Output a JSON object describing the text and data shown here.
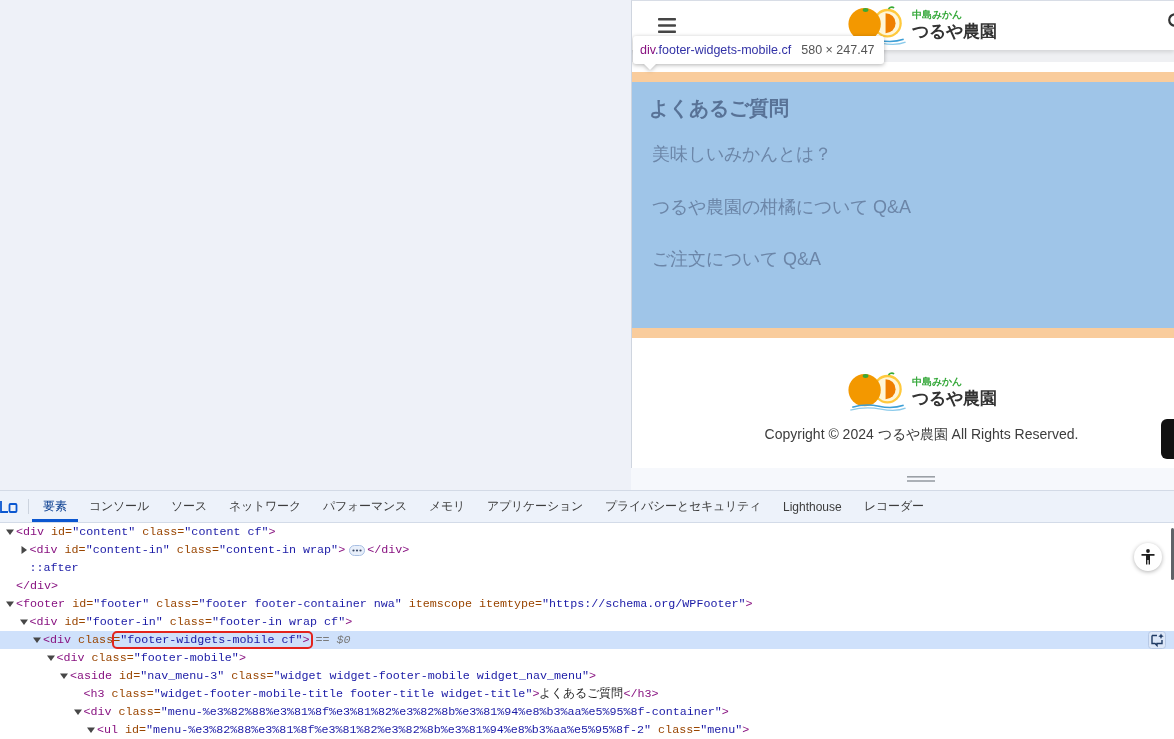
{
  "viewport": {
    "header": {
      "logo": {
        "tagline": "中島みかん",
        "name": "つるや農園"
      }
    },
    "inspect_tooltip": {
      "tag": "div",
      "classes": ".footer-widgets-mobile.cf",
      "size": "580 × 247.47"
    },
    "faq_widget": {
      "title": "よくあるご質問",
      "links": [
        "美味しいみかんとは？",
        "つるや農園の柑橘について Q&A",
        "ご注文について Q&A"
      ]
    },
    "footer": {
      "logo": {
        "tagline": "中島みかん",
        "name": "つるや農園"
      },
      "copyright": "Copyright © 2024 つるや農園 All Rights Reserved."
    }
  },
  "devtools": {
    "tabs": [
      {
        "label": "要素",
        "selected": true
      },
      {
        "label": "コンソール",
        "selected": false
      },
      {
        "label": "ソース",
        "selected": false
      },
      {
        "label": "ネットワーク",
        "selected": false
      },
      {
        "label": "パフォーマンス",
        "selected": false
      },
      {
        "label": "メモリ",
        "selected": false
      },
      {
        "label": "アプリケーション",
        "selected": false
      },
      {
        "label": "プライバシーとセキュリティ",
        "selected": false
      },
      {
        "label": "Lighthouse",
        "selected": false
      },
      {
        "label": "レコーダー",
        "selected": false
      }
    ],
    "dom_tree": [
      {
        "kind": "element",
        "markup": "<div id=\"content\" class=\"content cf\">",
        "expanded": true,
        "selected": false,
        "annotated": false,
        "closing": "</div>",
        "children": [
          {
            "kind": "element",
            "markup": "<div id=\"content-in\" class=\"content-in wrap\">",
            "expanded": false,
            "selected": false,
            "annotated": false,
            "closing": "</div>"
          },
          {
            "kind": "pseudo",
            "markup": "::after",
            "selected": false,
            "annotated": false
          }
        ]
      },
      {
        "kind": "element",
        "markup": "<footer id=\"footer\" class=\"footer footer-container nwa\" itemscope itemtype=\"https://schema.org/WPFooter\">",
        "expanded": true,
        "selected": false,
        "annotated": false,
        "children": [
          {
            "kind": "element",
            "markup": "<div id=\"footer-in\" class=\"footer-in wrap cf\">",
            "expanded": true,
            "selected": false,
            "annotated": false,
            "children": [
              {
                "kind": "element",
                "markup": "<div class=\"footer-widgets-mobile cf\">",
                "expanded": true,
                "selected": true,
                "annotated": true,
                "children": [
                  {
                    "kind": "element",
                    "markup": "<div class=\"footer-mobile\">",
                    "expanded": true,
                    "selected": false,
                    "annotated": false,
                    "children": [
                      {
                        "kind": "element",
                        "markup": "<aside id=\"nav_menu-3\" class=\"widget widget-footer-mobile widget_nav_menu\">",
                        "expanded": true,
                        "selected": false,
                        "annotated": false,
                        "children": [
                          {
                            "kind": "element",
                            "markup": "<h3 class=\"widget-footer-mobile-title footer-title widget-title\">よくあるご質問</h3>",
                            "selected": false,
                            "annotated": false
                          },
                          {
                            "kind": "element",
                            "markup": "<div class=\"menu-%e3%82%88%e3%81%8f%e3%81%82%e3%82%8b%e3%81%94%e8%b3%aa%e5%95%8f-container\">",
                            "expanded": true,
                            "selected": false,
                            "annotated": false,
                            "children": [
                              {
                                "kind": "element",
                                "markup": "<ul id=\"menu-%e3%82%88%e3%81%8f%e3%81%82%e3%82%8b%e3%81%94%e8%b3%aa%e5%95%8f-2\" class=\"menu\">",
                                "expanded": true,
                                "selected": false,
                                "annotated": false
                              }
                            ]
                          }
                        ]
                      }
                    ]
                  }
                ]
              }
            ]
          }
        ]
      }
    ],
    "selected_ref": "== $0"
  }
}
